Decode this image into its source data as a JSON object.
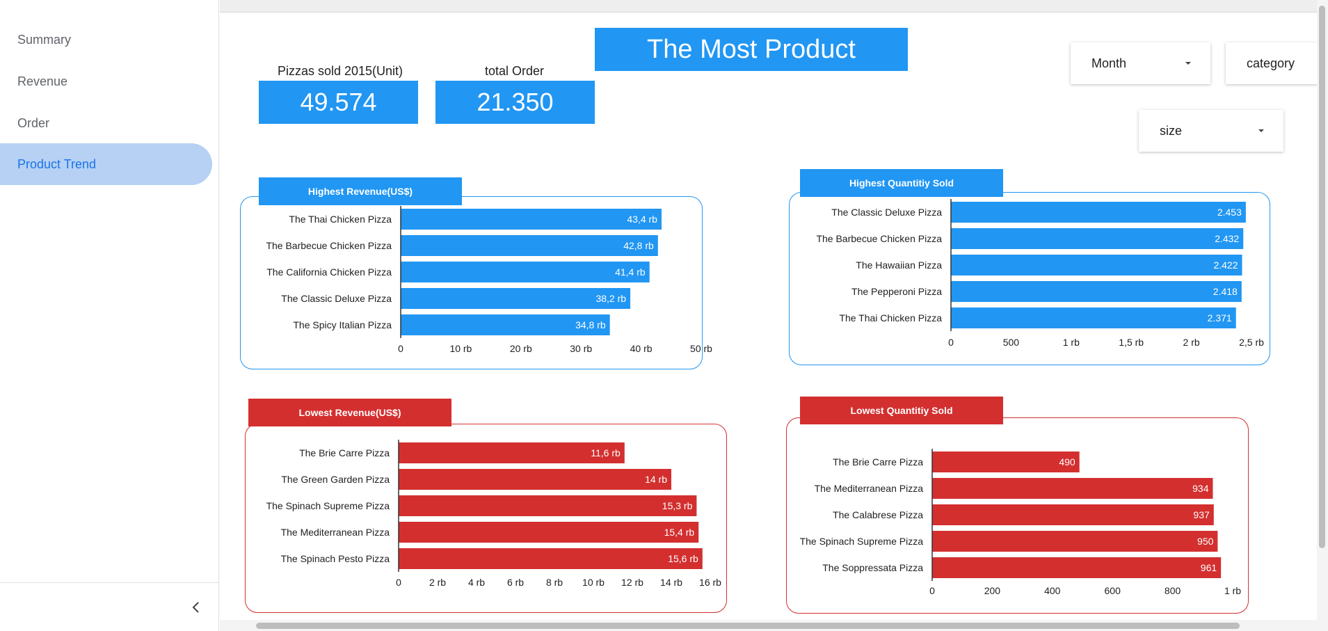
{
  "sidebar": {
    "items": [
      {
        "label": "Summary",
        "active": false
      },
      {
        "label": "Revenue",
        "active": false
      },
      {
        "label": "Order",
        "active": false
      },
      {
        "label": "Product Trend",
        "active": true
      }
    ]
  },
  "page": {
    "title": "The Most Product"
  },
  "kpis": [
    {
      "label": "Pizzas sold 2015(Unit)",
      "value": "49.574"
    },
    {
      "label": "total Order",
      "value": "21.350"
    }
  ],
  "filters": [
    {
      "label": "Month"
    },
    {
      "label": "category"
    },
    {
      "label": "size"
    }
  ],
  "colors": {
    "blue": "#2196f3",
    "red": "#d32f2f",
    "active_nav_bg": "#b6d1f4",
    "active_nav_text": "#1a73e8"
  },
  "icons": {
    "collapse": "chevron-left-icon",
    "dropdown": "caret-down-icon"
  },
  "chart_data": [
    {
      "type": "bar",
      "orientation": "horizontal",
      "title": "Highest Revenue(US$)",
      "categories": [
        "The Thai Chicken Pizza",
        "The Barbecue Chicken Pizza",
        "The California Chicken Pizza",
        "The Classic Deluxe Pizza",
        "The Spicy Italian Pizza"
      ],
      "values": [
        43400,
        42800,
        41400,
        38200,
        34800
      ],
      "value_labels": [
        "43,4 rb",
        "42,8 rb",
        "41,4 rb",
        "38,2 rb",
        "34,8 rb"
      ],
      "xlim": [
        0,
        50000
      ],
      "ticks": [
        0,
        10000,
        20000,
        30000,
        40000,
        50000
      ],
      "tick_labels": [
        "0",
        "10 rb",
        "20 rb",
        "30 rb",
        "40 rb",
        "50 rb"
      ],
      "color": "#2196f3"
    },
    {
      "type": "bar",
      "orientation": "horizontal",
      "title": "Highest Quantitiy Sold",
      "categories": [
        "The Classic Deluxe Pizza",
        "The Barbecue Chicken Pizza",
        "The Hawaiian Pizza",
        "The Pepperoni Pizza",
        "The Thai Chicken Pizza"
      ],
      "values": [
        2453,
        2432,
        2422,
        2418,
        2371
      ],
      "value_labels": [
        "2.453",
        "2.432",
        "2.422",
        "2.418",
        "2.371"
      ],
      "xlim": [
        0,
        2500
      ],
      "ticks": [
        0,
        500,
        1000,
        1500,
        2000,
        2500
      ],
      "tick_labels": [
        "0",
        "500",
        "1 rb",
        "1,5 rb",
        "2 rb",
        "2,5 rb"
      ],
      "color": "#2196f3"
    },
    {
      "type": "bar",
      "orientation": "horizontal",
      "title": "Lowest Revenue(US$)",
      "categories": [
        "The Brie Carre Pizza",
        "The Green Garden Pizza",
        "The Spinach Supreme Pizza",
        "The Mediterranean Pizza",
        "The Spinach Pesto Pizza"
      ],
      "values": [
        11600,
        14000,
        15300,
        15400,
        15600
      ],
      "value_labels": [
        "11,6 rb",
        "14 rb",
        "15,3 rb",
        "15,4 rb",
        "15,6 rb"
      ],
      "xlim": [
        0,
        16000
      ],
      "ticks": [
        0,
        2000,
        4000,
        6000,
        8000,
        10000,
        12000,
        14000,
        16000
      ],
      "tick_labels": [
        "0",
        "2 rb",
        "4 rb",
        "6 rb",
        "8 rb",
        "10 rb",
        "12 rb",
        "14 rb",
        "16 rb"
      ],
      "color": "#d32f2f"
    },
    {
      "type": "bar",
      "orientation": "horizontal",
      "title": "Lowest Quantitiy Sold",
      "categories": [
        "The Brie Carre Pizza",
        "The Mediterranean Pizza",
        "The Calabrese Pizza",
        "The Spinach Supreme Pizza",
        "The Soppressata Pizza"
      ],
      "values": [
        490,
        934,
        937,
        950,
        961
      ],
      "value_labels": [
        "490",
        "934",
        "937",
        "950",
        "961"
      ],
      "xlim": [
        0,
        1000
      ],
      "ticks": [
        0,
        200,
        400,
        600,
        800,
        1000
      ],
      "tick_labels": [
        "0",
        "200",
        "400",
        "600",
        "800",
        "1 rb"
      ],
      "color": "#d32f2f"
    }
  ]
}
